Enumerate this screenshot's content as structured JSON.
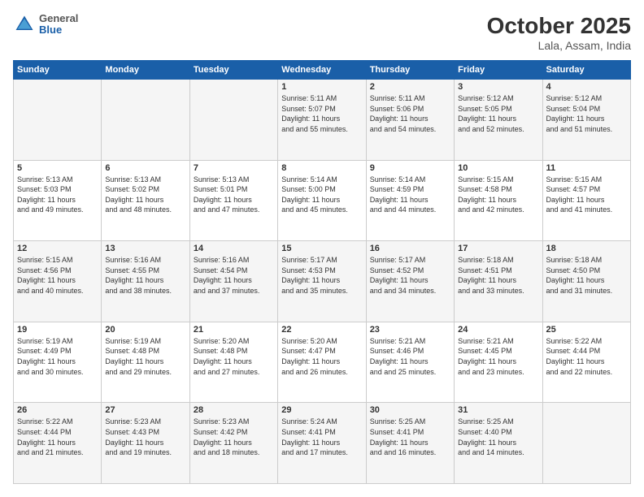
{
  "header": {
    "logo": {
      "general": "General",
      "blue": "Blue"
    },
    "title": "October 2025",
    "subtitle": "Lala, Assam, India"
  },
  "weekdays": [
    "Sunday",
    "Monday",
    "Tuesday",
    "Wednesday",
    "Thursday",
    "Friday",
    "Saturday"
  ],
  "weeks": [
    [
      {
        "day": "",
        "sunrise": "",
        "sunset": "",
        "daylight": ""
      },
      {
        "day": "",
        "sunrise": "",
        "sunset": "",
        "daylight": ""
      },
      {
        "day": "",
        "sunrise": "",
        "sunset": "",
        "daylight": ""
      },
      {
        "day": "1",
        "sunrise": "Sunrise: 5:11 AM",
        "sunset": "Sunset: 5:07 PM",
        "daylight": "Daylight: 11 hours and 55 minutes."
      },
      {
        "day": "2",
        "sunrise": "Sunrise: 5:11 AM",
        "sunset": "Sunset: 5:06 PM",
        "daylight": "Daylight: 11 hours and 54 minutes."
      },
      {
        "day": "3",
        "sunrise": "Sunrise: 5:12 AM",
        "sunset": "Sunset: 5:05 PM",
        "daylight": "Daylight: 11 hours and 52 minutes."
      },
      {
        "day": "4",
        "sunrise": "Sunrise: 5:12 AM",
        "sunset": "Sunset: 5:04 PM",
        "daylight": "Daylight: 11 hours and 51 minutes."
      }
    ],
    [
      {
        "day": "5",
        "sunrise": "Sunrise: 5:13 AM",
        "sunset": "Sunset: 5:03 PM",
        "daylight": "Daylight: 11 hours and 49 minutes."
      },
      {
        "day": "6",
        "sunrise": "Sunrise: 5:13 AM",
        "sunset": "Sunset: 5:02 PM",
        "daylight": "Daylight: 11 hours and 48 minutes."
      },
      {
        "day": "7",
        "sunrise": "Sunrise: 5:13 AM",
        "sunset": "Sunset: 5:01 PM",
        "daylight": "Daylight: 11 hours and 47 minutes."
      },
      {
        "day": "8",
        "sunrise": "Sunrise: 5:14 AM",
        "sunset": "Sunset: 5:00 PM",
        "daylight": "Daylight: 11 hours and 45 minutes."
      },
      {
        "day": "9",
        "sunrise": "Sunrise: 5:14 AM",
        "sunset": "Sunset: 4:59 PM",
        "daylight": "Daylight: 11 hours and 44 minutes."
      },
      {
        "day": "10",
        "sunrise": "Sunrise: 5:15 AM",
        "sunset": "Sunset: 4:58 PM",
        "daylight": "Daylight: 11 hours and 42 minutes."
      },
      {
        "day": "11",
        "sunrise": "Sunrise: 5:15 AM",
        "sunset": "Sunset: 4:57 PM",
        "daylight": "Daylight: 11 hours and 41 minutes."
      }
    ],
    [
      {
        "day": "12",
        "sunrise": "Sunrise: 5:15 AM",
        "sunset": "Sunset: 4:56 PM",
        "daylight": "Daylight: 11 hours and 40 minutes."
      },
      {
        "day": "13",
        "sunrise": "Sunrise: 5:16 AM",
        "sunset": "Sunset: 4:55 PM",
        "daylight": "Daylight: 11 hours and 38 minutes."
      },
      {
        "day": "14",
        "sunrise": "Sunrise: 5:16 AM",
        "sunset": "Sunset: 4:54 PM",
        "daylight": "Daylight: 11 hours and 37 minutes."
      },
      {
        "day": "15",
        "sunrise": "Sunrise: 5:17 AM",
        "sunset": "Sunset: 4:53 PM",
        "daylight": "Daylight: 11 hours and 35 minutes."
      },
      {
        "day": "16",
        "sunrise": "Sunrise: 5:17 AM",
        "sunset": "Sunset: 4:52 PM",
        "daylight": "Daylight: 11 hours and 34 minutes."
      },
      {
        "day": "17",
        "sunrise": "Sunrise: 5:18 AM",
        "sunset": "Sunset: 4:51 PM",
        "daylight": "Daylight: 11 hours and 33 minutes."
      },
      {
        "day": "18",
        "sunrise": "Sunrise: 5:18 AM",
        "sunset": "Sunset: 4:50 PM",
        "daylight": "Daylight: 11 hours and 31 minutes."
      }
    ],
    [
      {
        "day": "19",
        "sunrise": "Sunrise: 5:19 AM",
        "sunset": "Sunset: 4:49 PM",
        "daylight": "Daylight: 11 hours and 30 minutes."
      },
      {
        "day": "20",
        "sunrise": "Sunrise: 5:19 AM",
        "sunset": "Sunset: 4:48 PM",
        "daylight": "Daylight: 11 hours and 29 minutes."
      },
      {
        "day": "21",
        "sunrise": "Sunrise: 5:20 AM",
        "sunset": "Sunset: 4:48 PM",
        "daylight": "Daylight: 11 hours and 27 minutes."
      },
      {
        "day": "22",
        "sunrise": "Sunrise: 5:20 AM",
        "sunset": "Sunset: 4:47 PM",
        "daylight": "Daylight: 11 hours and 26 minutes."
      },
      {
        "day": "23",
        "sunrise": "Sunrise: 5:21 AM",
        "sunset": "Sunset: 4:46 PM",
        "daylight": "Daylight: 11 hours and 25 minutes."
      },
      {
        "day": "24",
        "sunrise": "Sunrise: 5:21 AM",
        "sunset": "Sunset: 4:45 PM",
        "daylight": "Daylight: 11 hours and 23 minutes."
      },
      {
        "day": "25",
        "sunrise": "Sunrise: 5:22 AM",
        "sunset": "Sunset: 4:44 PM",
        "daylight": "Daylight: 11 hours and 22 minutes."
      }
    ],
    [
      {
        "day": "26",
        "sunrise": "Sunrise: 5:22 AM",
        "sunset": "Sunset: 4:44 PM",
        "daylight": "Daylight: 11 hours and 21 minutes."
      },
      {
        "day": "27",
        "sunrise": "Sunrise: 5:23 AM",
        "sunset": "Sunset: 4:43 PM",
        "daylight": "Daylight: 11 hours and 19 minutes."
      },
      {
        "day": "28",
        "sunrise": "Sunrise: 5:23 AM",
        "sunset": "Sunset: 4:42 PM",
        "daylight": "Daylight: 11 hours and 18 minutes."
      },
      {
        "day": "29",
        "sunrise": "Sunrise: 5:24 AM",
        "sunset": "Sunset: 4:41 PM",
        "daylight": "Daylight: 11 hours and 17 minutes."
      },
      {
        "day": "30",
        "sunrise": "Sunrise: 5:25 AM",
        "sunset": "Sunset: 4:41 PM",
        "daylight": "Daylight: 11 hours and 16 minutes."
      },
      {
        "day": "31",
        "sunrise": "Sunrise: 5:25 AM",
        "sunset": "Sunset: 4:40 PM",
        "daylight": "Daylight: 11 hours and 14 minutes."
      },
      {
        "day": "",
        "sunrise": "",
        "sunset": "",
        "daylight": ""
      }
    ]
  ]
}
